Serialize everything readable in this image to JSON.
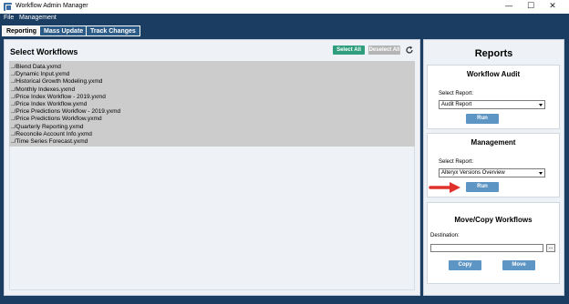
{
  "window": {
    "title": "Workflow Admin Manager",
    "minimize_glyph": "—",
    "maximize_glyph": "☐",
    "close_glyph": "✕"
  },
  "menu": {
    "file": "File",
    "management": "Management"
  },
  "tabs": [
    {
      "label": "Reporting",
      "active": true
    },
    {
      "label": "Mass Update",
      "active": false
    },
    {
      "label": "Track Changes",
      "active": false
    }
  ],
  "workflows": {
    "title": "Select Workflows",
    "select_all": "Select All",
    "deselect_all": "Deselect All",
    "items": [
      "../Blend Data.yxmd",
      "../Dynamic Input.yxmd",
      "../Historical Growth Modeling.yxmd",
      "../Monthly Indexes.yxmd",
      "../Price Index Workflow - 2019.yxmd",
      "../Price Index Workflow.yxmd",
      "../Price Predictions Workflow - 2019.yxmd",
      "../Price Predictions Workflow.yxmd",
      "../Quarterly Reporting.yxmd",
      "../Reconcile Account Info.yxmd",
      "../Time Series Forecast.yxmd"
    ]
  },
  "reports": {
    "title": "Reports",
    "workflow_audit": {
      "title": "Workflow Audit",
      "select_label": "Select Report:",
      "selected": "Audit Report",
      "run": "Run"
    },
    "management": {
      "title": "Management",
      "select_label": "Select Report:",
      "selected": "Alteryx Versions Overview",
      "run": "Run"
    },
    "move_copy": {
      "title": "Move/Copy Workflows",
      "destination_label": "Destination:",
      "destination_value": "",
      "browse": "...",
      "copy": "Copy",
      "move": "Move"
    }
  },
  "colors": {
    "frame": "#1c3d62",
    "panel": "#eef2f6",
    "select_all": "#2e9e7d",
    "deselect_all": "#b5b5b5",
    "run_button": "#5d95c4",
    "arrow": "#e0302a"
  }
}
